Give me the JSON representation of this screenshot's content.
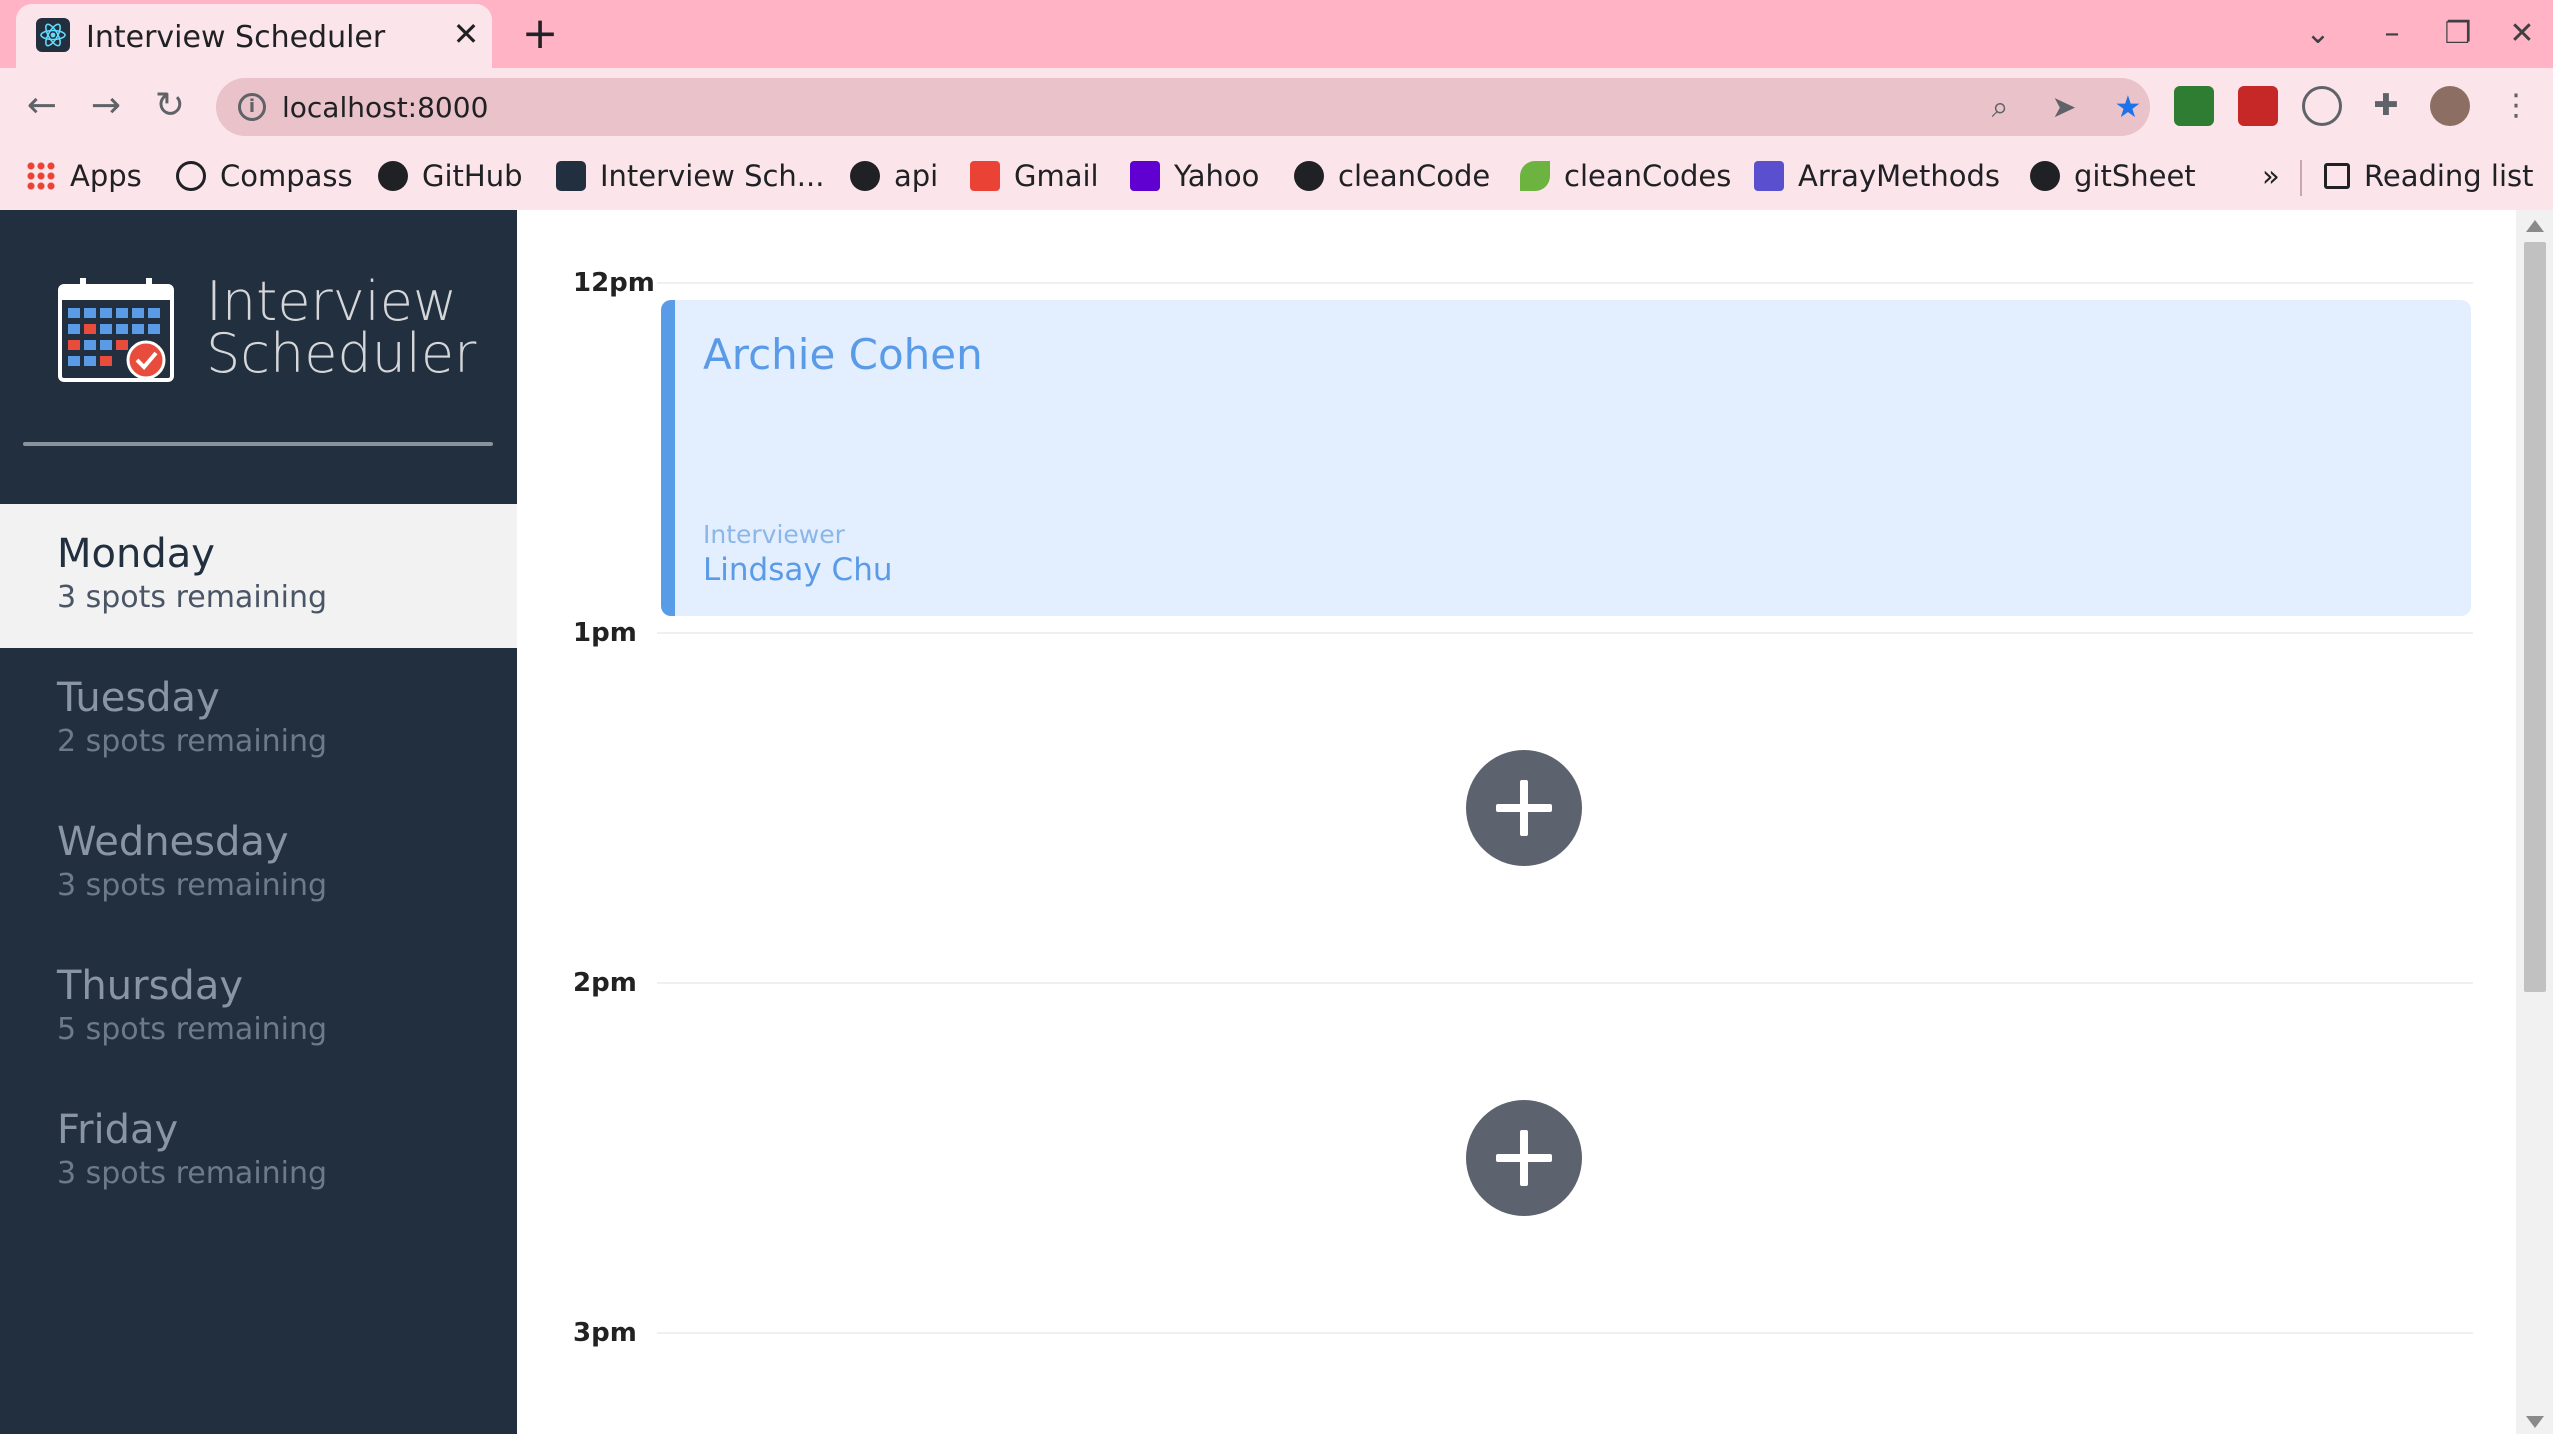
{
  "browser": {
    "tab_title": "Interview Scheduler",
    "tab_close": "✕",
    "new_tab": "+",
    "url": "localhost:8000",
    "bookmarks": [
      {
        "label": "Apps",
        "icon": "apps-grid-icon"
      },
      {
        "label": "Compass",
        "icon": "compass-icon"
      },
      {
        "label": "GitHub",
        "icon": "github-icon"
      },
      {
        "label": "Interview Sch...",
        "icon": "react-icon"
      },
      {
        "label": "api",
        "icon": "globe-icon"
      },
      {
        "label": "Gmail",
        "icon": "gmail-icon"
      },
      {
        "label": "Yahoo",
        "icon": "yahoo-mail-icon"
      },
      {
        "label": "cleanCode",
        "icon": "github-icon"
      },
      {
        "label": "cleanCodes",
        "icon": "leaf-icon"
      },
      {
        "label": "ArrayMethods",
        "icon": "code-icon"
      },
      {
        "label": "gitSheet",
        "icon": "globe-icon"
      }
    ],
    "overflow": "»",
    "reading_list": "Reading list"
  },
  "app": {
    "logo_line1": "Interview",
    "logo_line2": "Scheduler",
    "days": [
      {
        "name": "Monday",
        "spots": "3 spots remaining",
        "selected": true
      },
      {
        "name": "Tuesday",
        "spots": "2 spots remaining",
        "selected": false
      },
      {
        "name": "Wednesday",
        "spots": "3 spots remaining",
        "selected": false
      },
      {
        "name": "Thursday",
        "spots": "5 spots remaining",
        "selected": false
      },
      {
        "name": "Friday",
        "spots": "3 spots remaining",
        "selected": false
      }
    ],
    "slots": [
      {
        "time": "12pm",
        "student": "Archie Cohen",
        "interviewer_label": "Interviewer",
        "interviewer": "Lindsay Chu"
      },
      {
        "time": "1pm"
      },
      {
        "time": "2pm"
      },
      {
        "time": "3pm"
      }
    ]
  },
  "colors": {
    "sidebar_bg": "#222f3e",
    "accent_blue": "#5a9be8",
    "card_bg": "#e3efff",
    "add_button": "#5c636e",
    "tabbar": "#ffb3c4"
  }
}
